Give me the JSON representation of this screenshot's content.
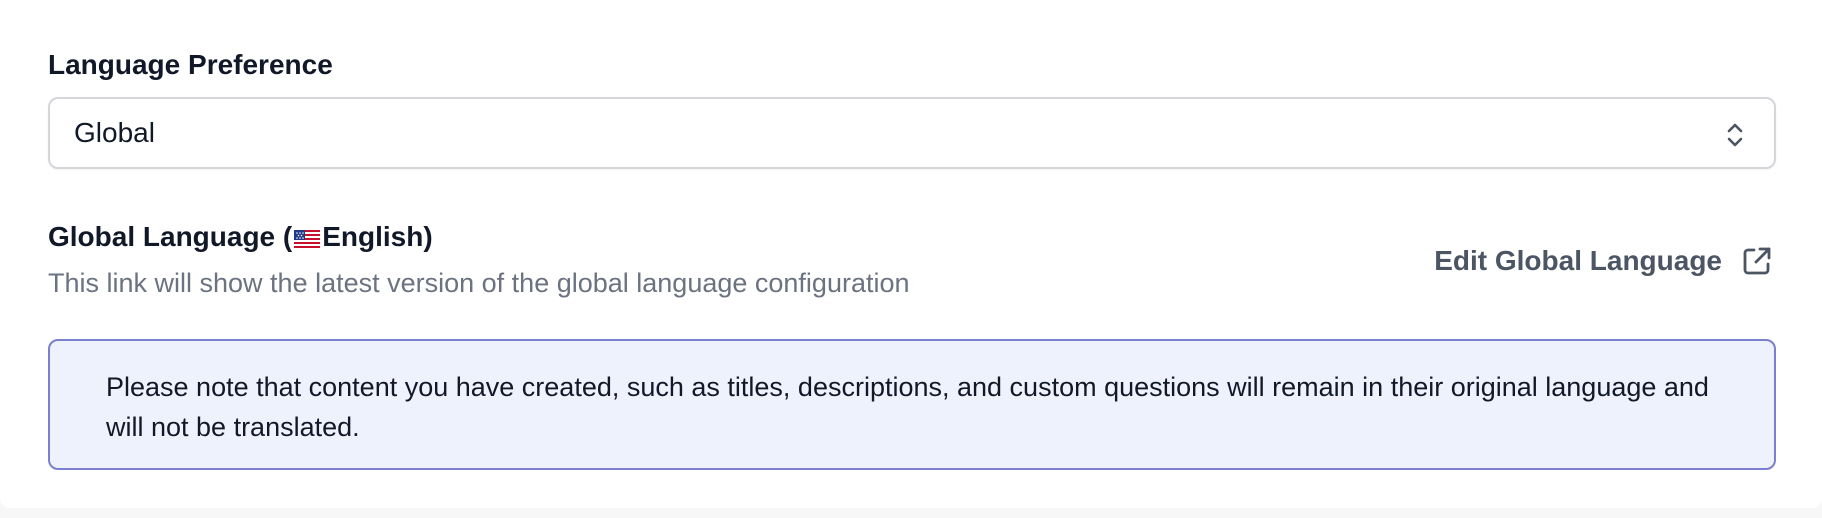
{
  "language_preference": {
    "label": "Language Preference",
    "selected_value": "Global",
    "chevron_icon": "chevron-up-down-icon"
  },
  "global_language": {
    "title_prefix": "Global Language (",
    "flag_icon": "us-flag-icon",
    "language_name": "English",
    "title_suffix": ")",
    "description": "This link will show the latest version of the global language configuration"
  },
  "edit_link": {
    "label": "Edit Global Language",
    "icon": "external-link-icon"
  },
  "notice": {
    "text": "Please note that content you have created, such as titles, descriptions, and custom questions will remain in their original language and will not be translated."
  },
  "colors": {
    "notice_background": "#eef2fd",
    "notice_border": "#7c7fcf",
    "muted_text": "#6b7280",
    "link_text": "#4b5563"
  }
}
